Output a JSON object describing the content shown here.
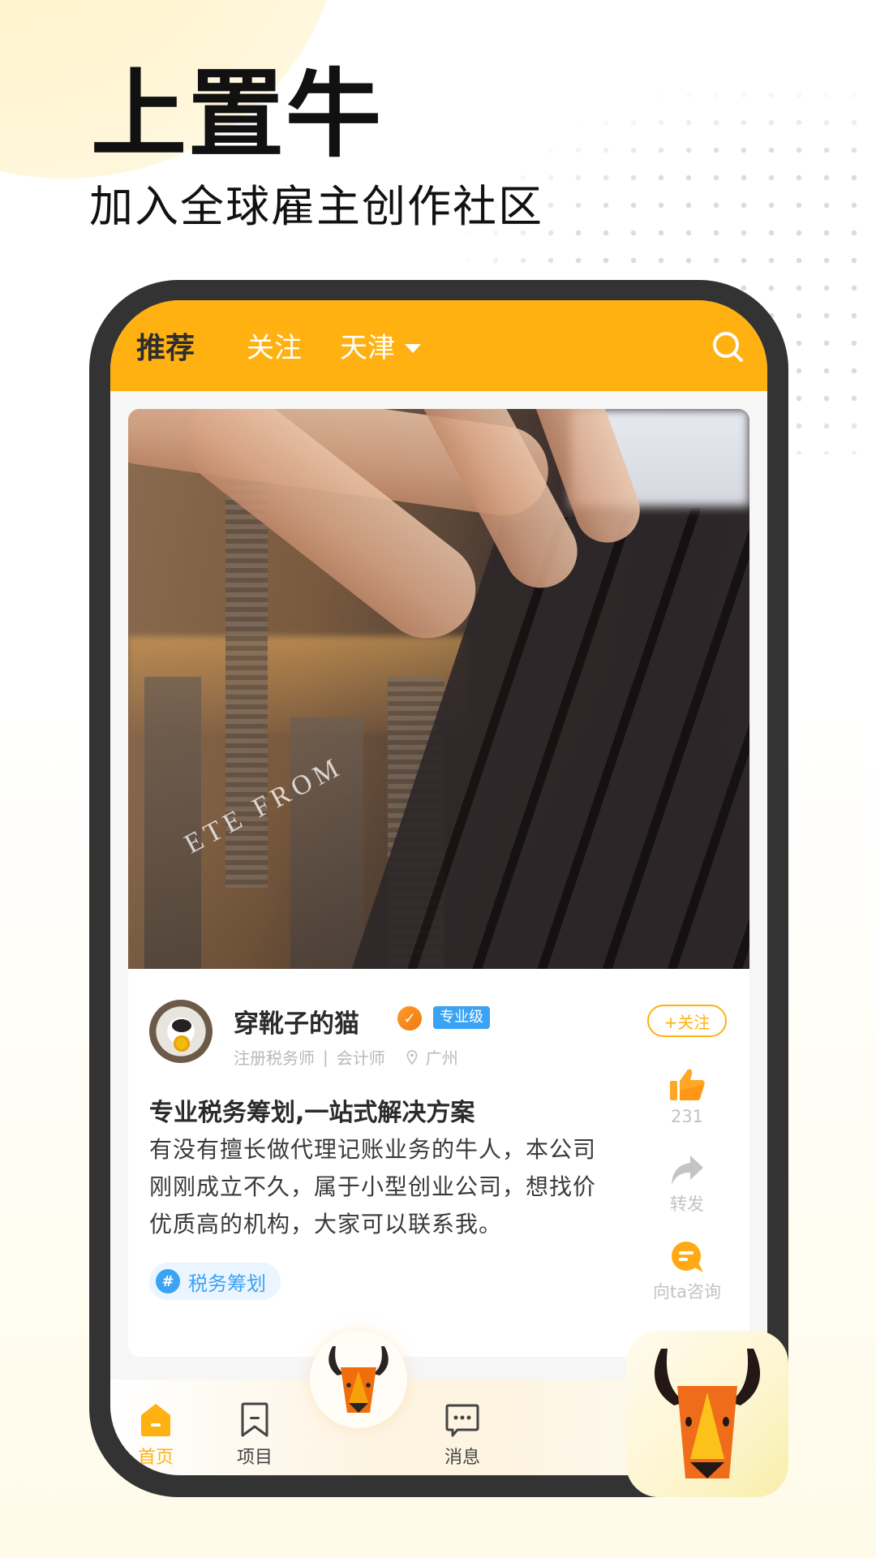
{
  "hero": {
    "title": "上置牛",
    "subtitle": "加入全球雇主创作社区"
  },
  "app": {
    "accent_color": "#ffb111",
    "tabs": [
      {
        "label": "推荐",
        "active": true
      },
      {
        "label": "关注",
        "active": false
      }
    ],
    "city_selector": {
      "label": "天津",
      "icon": "caret-down-icon"
    },
    "search_icon": "search-icon"
  },
  "post": {
    "photo_overlay_text": "ETE FROM",
    "author": {
      "name": "穿靴子的猫",
      "verify_icon": "verified-user-icon",
      "level_badge": "专业级",
      "titles": "注册税务师",
      "separator": "|",
      "titles2": "会计师",
      "location": "广州"
    },
    "follow_label": "+关注",
    "title": "专业税务筹划,一站式解决方案",
    "body": "有没有擅长做代理记账业务的牛人，本公司刚刚成立不久，属于小型创业公司，想找价优质高的机构，大家可以联系我。",
    "tag": {
      "hash": "#",
      "label": "税务筹划"
    },
    "actions": {
      "like_count": "231",
      "share_label": "转发",
      "ask_label": "向ta咨询"
    }
  },
  "bottom_nav": {
    "items": [
      {
        "label": "首页",
        "icon": "home-icon",
        "active": true
      },
      {
        "label": "项目",
        "icon": "bookmark-icon",
        "active": false
      },
      {
        "label": "消息",
        "icon": "message-icon",
        "active": false
      }
    ],
    "center_icon": "bull-logo-icon"
  }
}
